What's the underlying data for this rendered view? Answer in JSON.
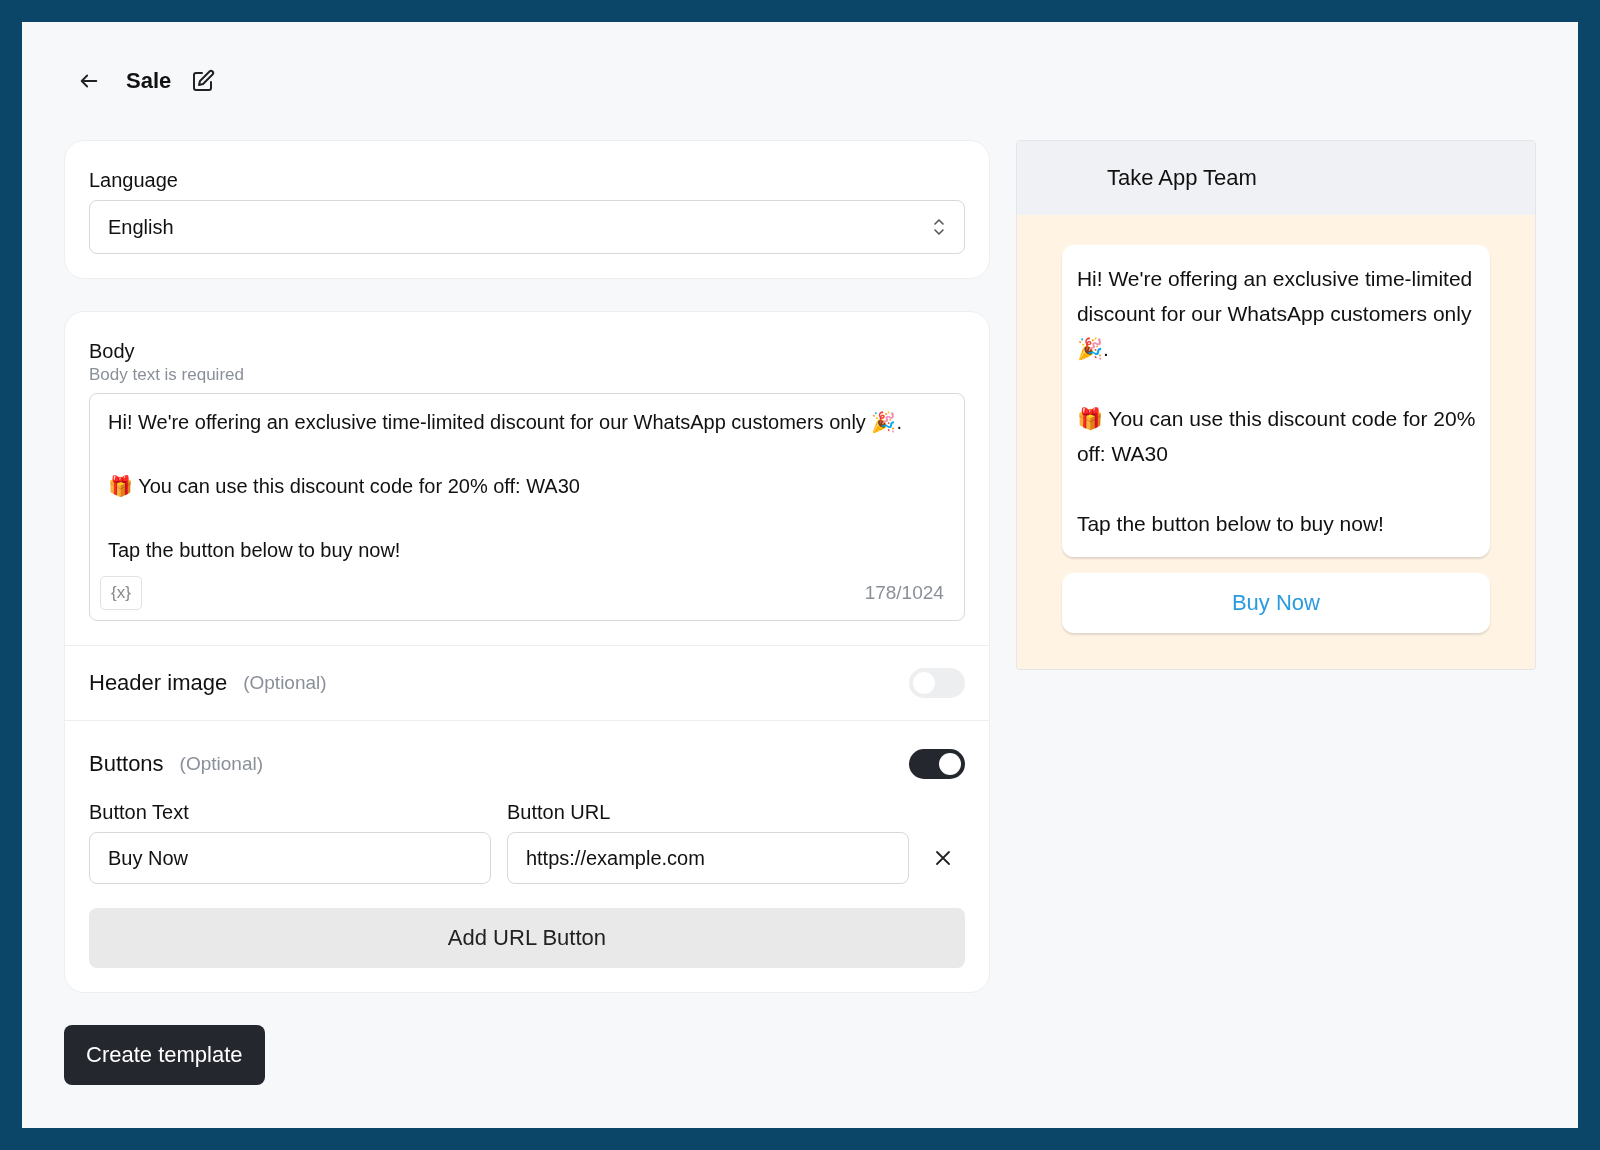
{
  "header": {
    "title": "Sale"
  },
  "language": {
    "label": "Language",
    "value": "English"
  },
  "body": {
    "label": "Body",
    "hint": "Body text is required",
    "value": "Hi! We're offering an exclusive time-limited discount for our WhatsApp customers only 🎉.\n\n🎁 You can use this discount code for 20% off: WA30\n\nTap the button below to buy now!",
    "variable_button": "{x}",
    "counter": "178/1024"
  },
  "header_image": {
    "label": "Header image",
    "note": "(Optional)",
    "on": false
  },
  "buttons": {
    "label": "Buttons",
    "note": "(Optional)",
    "on": true,
    "text_label": "Button Text",
    "url_label": "Button URL",
    "rows": [
      {
        "text": "Buy Now",
        "url": "https://example.com"
      }
    ],
    "add_button": "Add URL Button"
  },
  "create_button": "Create template",
  "preview": {
    "title": "Take App Team",
    "message": "Hi! We're offering an exclusive time-limited discount for our WhatsApp customers only 🎉.\n\n🎁 You can use this discount code for 20% off: WA30\n\nTap the button below to buy now!",
    "buttons": [
      "Buy Now"
    ]
  }
}
